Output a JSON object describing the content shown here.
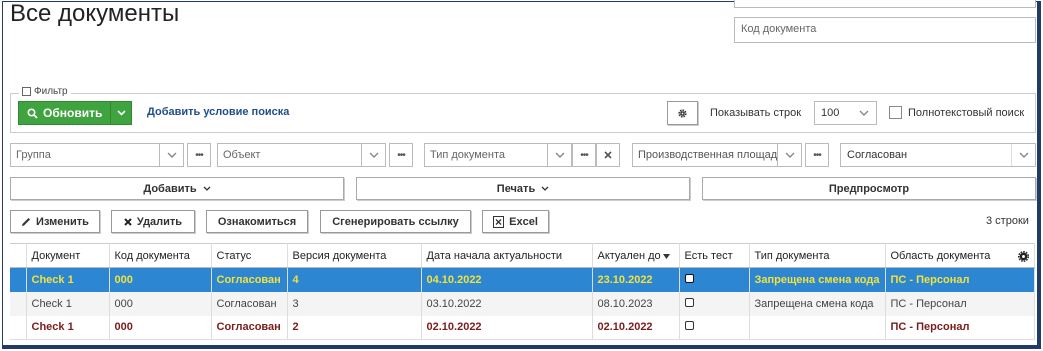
{
  "page": {
    "title": "Все документы"
  },
  "top": {
    "doc_code_placeholder": "Код документа"
  },
  "filter": {
    "legend": "Фильтр",
    "refresh_label": "Обновить",
    "add_condition_label": "Добавить условие поиска",
    "show_rows_label": "Показывать строк",
    "rows_value": "100",
    "fulltext_label": "Полнотекстовый поиск",
    "group_placeholder": "Группа",
    "object_placeholder": "Объект",
    "doc_type_placeholder": "Тип документа",
    "production_placeholder": "Производственная площадка",
    "status_value": "Согласован"
  },
  "actions": {
    "add": "Добавить",
    "print": "Печать",
    "preview": "Предпросмотр"
  },
  "toolbar": {
    "edit": "Изменить",
    "delete": "Удалить",
    "acquaint": "Ознакомиться",
    "gen_link": "Сгенерировать ссылку",
    "excel": "Excel",
    "row_count": "3 строки"
  },
  "table": {
    "headers": [
      "Документ",
      "Код документа",
      "Статус",
      "Версия документа",
      "Дата начала актуальности",
      "Актуален до",
      "Есть тест",
      "Тип документа",
      "Область документа"
    ],
    "rows": [
      {
        "doc": "Check 1",
        "code": "000",
        "status": "Согласован",
        "version": "4",
        "start": "04.10.2022",
        "until": "23.10.2022",
        "type": "Запрещена смена кода",
        "area": "ПС - Персонал"
      },
      {
        "doc": "Check 1",
        "code": "000",
        "status": "Согласован",
        "version": "3",
        "start": "03.10.2022",
        "until": "08.10.2023",
        "type": "Запрещена смена кода",
        "area": "ПС - Персонал"
      },
      {
        "doc": "Check 1",
        "code": "000",
        "status": "Согласован",
        "version": "2",
        "start": "02.10.2022",
        "until": "02.10.2022",
        "type": "",
        "area": "ПС - Персонал"
      }
    ]
  },
  "colors": {
    "accent": "#3fa33f",
    "selected_row": "#2d86d2",
    "selected_text": "#f2e23a",
    "frame": "#1f3b66"
  }
}
